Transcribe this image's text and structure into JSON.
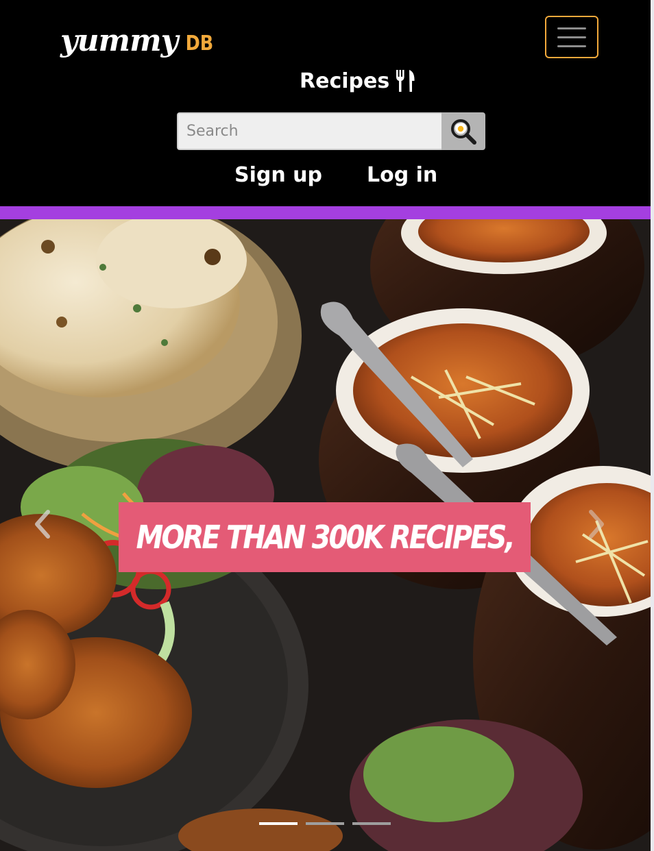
{
  "header": {
    "logo_main": "yummy",
    "logo_accent": "DB",
    "recipes_label": "Recipes",
    "search": {
      "placeholder": "Search",
      "value": ""
    },
    "signup_label": "Sign up",
    "login_label": "Log in"
  },
  "hero": {
    "caption": "MORE THAN 300K RECIPES,",
    "slide_count": 3,
    "active_slide": 1
  },
  "colors": {
    "accent_orange": "#f2a93b",
    "divider_purple": "#a43fe0",
    "caption_pink": "#e45b76"
  },
  "icons": [
    "hamburger-icon",
    "fork-knife-icon",
    "search-egg-icon",
    "chevron-left-icon",
    "chevron-right-icon"
  ]
}
